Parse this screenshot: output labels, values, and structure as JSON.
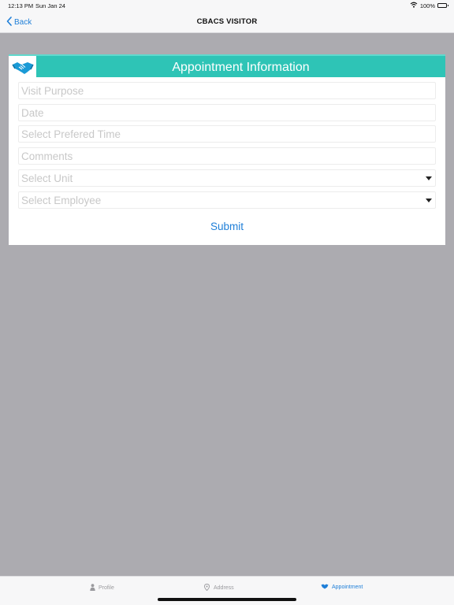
{
  "status_bar": {
    "time": "12:13 PM",
    "date": "Sun Jan 24",
    "battery": "100%"
  },
  "nav": {
    "back_label": "Back",
    "title": "CBACS VISITOR"
  },
  "form": {
    "header_icon": "handshake-icon",
    "title": "Appointment Information",
    "fields": {
      "visit_purpose": "Visit Purpose",
      "date": "Date",
      "preferred_time": "Select Prefered Time",
      "comments": "Comments",
      "unit": "Select Unit",
      "employee": "Select Employee"
    },
    "submit_label": "Submit"
  },
  "tab_bar": {
    "tabs": [
      {
        "label": "Profile",
        "icon": "person-icon",
        "active": false
      },
      {
        "label": "Address",
        "icon": "map-pin-icon",
        "active": false
      },
      {
        "label": "Appointment",
        "icon": "handshake-icon",
        "active": true
      }
    ]
  },
  "colors": {
    "accent": "#1f7fd8",
    "header_teal": "#2ec4b6",
    "background": "#acabb0"
  }
}
